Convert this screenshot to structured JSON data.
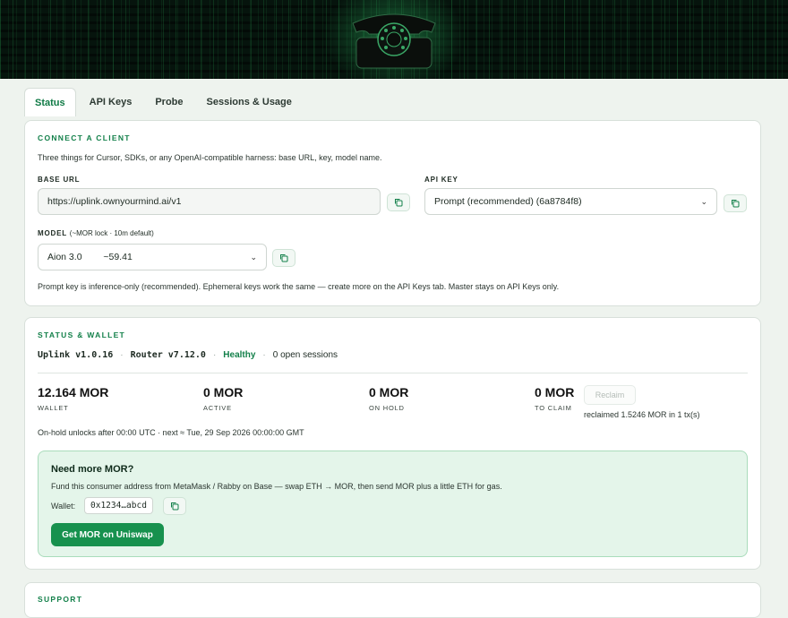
{
  "tabs": [
    "Status",
    "API Keys",
    "Probe",
    "Sessions & Usage"
  ],
  "connect": {
    "title": "CONNECT A CLIENT",
    "desc": "Three things for Cursor, SDKs, or any OpenAI-compatible harness: base URL, key, model name.",
    "base_url_label": "BASE URL",
    "base_url_value": "https://uplink.ownyourmind.ai/v1",
    "api_key_label": "API KEY",
    "api_key_selected": "Prompt (recommended) (6a8784f8)",
    "model_label": "MODEL",
    "model_sub": "(~MOR lock · 10m default)",
    "model_name": "Aion 3.0",
    "model_price": "~59.41",
    "note": "Prompt key is inference-only (recommended). Ephemeral keys work the same — create more on the API Keys tab. Master stays on API Keys only."
  },
  "status": {
    "title": "STATUS & WALLET",
    "uplink_version": "Uplink v1.0.16",
    "router_version": "Router v7.12.0",
    "health": "Healthy",
    "sessions": "0 open sessions",
    "separator": "·",
    "stats": [
      {
        "value": "12.164 MOR",
        "label": "WALLET"
      },
      {
        "value": "0 MOR",
        "label": "ACTIVE"
      },
      {
        "value": "0 MOR",
        "label": "ON HOLD"
      },
      {
        "value": "0 MOR",
        "label": "TO CLAIM"
      }
    ],
    "reclaim_label": "Reclaim",
    "reclaimed_text": "reclaimed 1.5246 MOR in 1 tx(s)",
    "unlock_text": "On-hold unlocks after 00:00 UTC · next ≈ Tue, 29 Sep 2026 00:00:00 GMT"
  },
  "funding": {
    "title": "Need more MOR?",
    "desc": "Fund this consumer address from MetaMask / Rabby on Base — swap ETH → MOR, then send MOR plus a little ETH for gas.",
    "wallet_label": "Wallet:",
    "wallet_addr": "0x1234…abcd",
    "button": "Get MOR on Uniswap"
  },
  "support": {
    "title": "SUPPORT"
  },
  "colors": {
    "accent": "#13804a",
    "button": "#17914e",
    "healthy": "#13804a",
    "banner": "#06140d"
  },
  "icons": {
    "copy": "copy-icon",
    "hero": "rotary-phone-icon",
    "chevron": "chevron-down-icon"
  }
}
